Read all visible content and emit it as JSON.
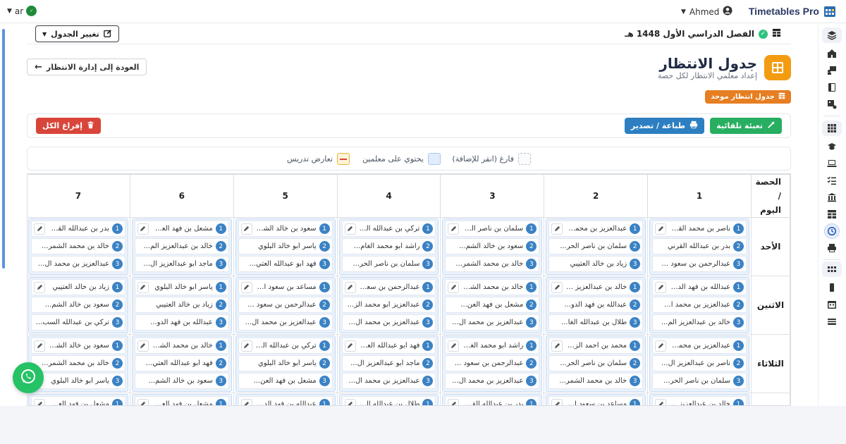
{
  "topbar": {
    "brand": "Timetables Pro",
    "user": "Ahmed",
    "lang": "ar"
  },
  "term": {
    "title": "الفصل الدراسي الأول 1448 هـ",
    "change_label": "تغيير الجدول"
  },
  "page": {
    "title": "جدول الانتظار",
    "subtitle": "إعداد معلمي الانتظار لكل حصة",
    "badge": "جدول انتظار موحد",
    "back_label": "العودة إلى إدارة الانتظار"
  },
  "actions": {
    "autofill": "تعبئة تلقائية",
    "print": "طباعة / تصدير",
    "clear_all": "إفراغ الكل"
  },
  "legend": {
    "empty": "فارغ (انقر للإضافة)",
    "has_teachers": "يحتوي على معلمين",
    "conflict": "تعارض تدريس"
  },
  "colors": {
    "accent_orange": "#f39c12",
    "green": "#27ae60",
    "blue": "#2d7fc1",
    "red": "#d9453a",
    "cell_blue": "#eaf2fc"
  },
  "grid": {
    "corner_line1": "الحصة /",
    "corner_line2": "اليوم",
    "periods": [
      "1",
      "2",
      "3",
      "4",
      "5",
      "6",
      "7"
    ],
    "days": [
      {
        "name": "الأحد",
        "cells": [
          [
            "ناصر بن محمد القح...",
            "بدر بن عبدالله القرني",
            "عبدالرحمن بن سعود ..."
          ],
          [
            "عبدالعزيز بن محمد ا...",
            "سلمان بن ناصر الحر...",
            "زياد بن خالد العتيبي"
          ],
          [
            "سلمان بن ناصر الحر...",
            "سعود بن خالد الشم...",
            "خالد بن محمد الشمر..."
          ],
          [
            "تركي بن عبدالله السب...",
            "راشد أبو محمد الغام...",
            "سلمان بن ناصر الحر..."
          ],
          [
            "سعود بن خالد الشم...",
            "ياسر أبو خالد البلوي",
            "فهد أبو عبدالله العتي..."
          ],
          [
            "مشعل بن فهد العن...",
            "خالد بن عبدالعزيز الم...",
            "ماجد أبو عبدالعزيز ال..."
          ],
          [
            "بدر بن عبدالله القرني",
            "خالد بن محمد الشمر...",
            "عبدالعزيز بن محمد ال..."
          ]
        ]
      },
      {
        "name": "الاثنين",
        "cells": [
          [
            "عبدالله بن فهد الدو...",
            "عبدالعزيز بن محمد ا...",
            "خالد بن عبدالعزيز الم..."
          ],
          [
            "خالد بن عبدالعزيز الم...",
            "عبدالله بن فهد الدو...",
            "طلال بن عبدالله الغا..."
          ],
          [
            "خالد بن محمد الشمر...",
            "مشعل بن فهد العن...",
            "عبدالعزيز بن محمد ال..."
          ],
          [
            "عبدالرحمن بن سعود ...",
            "عبدالعزيز أبو محمد الزهرا...",
            "عبدالعزيز بن محمد ال..."
          ],
          [
            "مساعد بن سعود الق...",
            "عبدالرحمن بن سعود ...",
            "عبدالعزيز بن محمد ال..."
          ],
          [
            "ياسر أبو خالد البلوي",
            "زياد بن خالد العتيبي",
            "عبدالله بن فهد الدو..."
          ],
          [
            "زياد بن خالد العتيبي",
            "سعود بن خالد الشم...",
            "تركي بن عبدالله السب..."
          ]
        ]
      },
      {
        "name": "الثلاثاء",
        "cells": [
          [
            "عبدالعزيز بن محمد ال...",
            "ناصر بن عبدالعزيز ال...",
            "سلمان بن ناصر الحر..."
          ],
          [
            "محمد بن أحمد الزهرا...",
            "سلمان بن ناصر الحر...",
            "خالد بن محمد الشمر..."
          ],
          [
            "راشد أبو محمد الغام...",
            "عبدالرحمن بن سعود ...",
            "عبدالعزيز بن محمد ال..."
          ],
          [
            "فهد أبو عبدالله العتي...",
            "ماجد أبو عبدالعزيز ال...",
            "عبدالعزيز بن محمد ال..."
          ],
          [
            "تركي بن عبدالله السب...",
            "ياسر أبو خالد البلوي",
            "مشعل بن فهد العن..."
          ],
          [
            "خالد بن محمد الشمر...",
            "فهد أبو عبدالله العتي...",
            "سعود بن خالد الشم..."
          ],
          [
            "سعود بن خالد الشم...",
            "خالد بن محمد الشمر...",
            "ياسر أبو خالد البلوي"
          ]
        ]
      },
      {
        "name": "",
        "cells": [
          [
            "خالد بن عبدالعزيز الم...",
            "",
            ""
          ],
          [
            "مساعد بن سعود الق...",
            "",
            ""
          ],
          [
            "بدر بن عبدالله القرني",
            "",
            ""
          ],
          [
            "طلال بن عبدالله الغا...",
            "",
            ""
          ],
          [
            "عبدالله بن فهد الدو...",
            "",
            ""
          ],
          [
            "مشعل بن فهد العن...",
            "",
            ""
          ],
          [
            "مشعل بن فهد العن...",
            "",
            ""
          ]
        ]
      }
    ]
  }
}
